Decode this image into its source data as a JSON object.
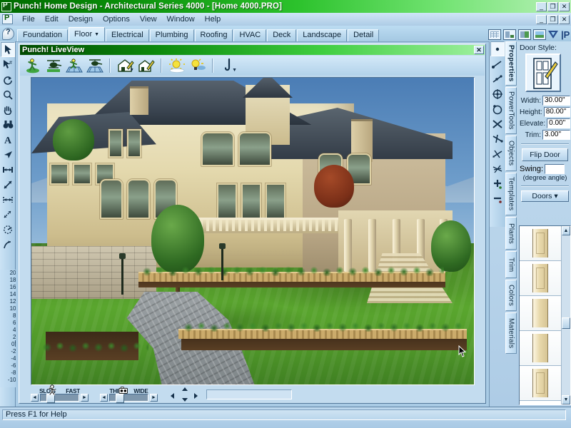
{
  "window": {
    "title": "Punch! Home Design - Architectural Series 4000 - [Home 4000.PRO]",
    "minimize": "_",
    "restore": "❐",
    "close": "✕",
    "app_icon": "punch-logo-icon"
  },
  "menu": {
    "items": [
      "File",
      "Edit",
      "Design",
      "Options",
      "View",
      "Window",
      "Help"
    ]
  },
  "tabs": {
    "items": [
      {
        "label": "Foundation",
        "active": false,
        "caret": false
      },
      {
        "label": "Floor",
        "active": true,
        "caret": true
      },
      {
        "label": "Electrical",
        "active": false,
        "caret": false
      },
      {
        "label": "Plumbing",
        "active": false,
        "caret": false
      },
      {
        "label": "Roofing",
        "active": false,
        "caret": false
      },
      {
        "label": "HVAC",
        "active": false,
        "caret": false
      },
      {
        "label": "Deck",
        "active": false,
        "caret": false
      },
      {
        "label": "Landscape",
        "active": false,
        "caret": false
      },
      {
        "label": "Detail",
        "active": false,
        "caret": false
      }
    ],
    "view_buttons": [
      "grid-view-icon",
      "left-split-view-icon",
      "two-column-view-icon",
      "full-render-view-icon"
    ],
    "logos": [
      "filter-logo-icon",
      "punch-p-logo-icon"
    ]
  },
  "left_toolbar": {
    "tools": [
      "select-arrow-icon",
      "select-group-icon",
      "rotate-icon",
      "zoom-magnifier-icon",
      "pan-hand-icon",
      "binoculars-icon",
      "text-tool-icon",
      "arrow-pointer-icon",
      "dimension-icon",
      "diagonal-arrow-icon",
      "bracket-dimension-icon",
      "diagonal-measure-icon",
      "angle-measure-icon",
      "curve-arrow-icon"
    ]
  },
  "ruler": {
    "ticks": [
      "20'",
      "18'",
      "16'",
      "14'",
      "12'",
      "10'",
      "8'",
      "6'",
      "4'",
      "2'",
      "0'",
      "-2'",
      "-4'",
      "-6'",
      "-8'",
      "-10'"
    ],
    "current": "0'"
  },
  "liveview": {
    "title": "Punch! LiveView",
    "close": "✕",
    "tools": [
      "walk-through-icon",
      "fly-through-icon",
      "walk-on-plan-icon",
      "fly-on-plan-icon",
      "house-edit-icon",
      "house-edit-alt-icon",
      "sun-light-icon",
      "bulb-light-icon",
      "pen-tool-icon"
    ],
    "controls": {
      "speed": {
        "min_label": "SLOW",
        "max_label": "FAST",
        "glyph": "walking-person-icon"
      },
      "width": {
        "min_label": "THIN",
        "max_label": "WIDE",
        "glyph": "camera-icon"
      },
      "dpad": "direction-pad-icon"
    }
  },
  "properties": {
    "door_style_label": "Door Style:",
    "door_style_icon": "door-preview-icon",
    "fields": [
      {
        "label": "Width:",
        "value": "30.00\""
      },
      {
        "label": "Height:",
        "value": "80.00\""
      },
      {
        "label": "Elevate:",
        "value": "0.00\""
      },
      {
        "label": "Trim:",
        "value": "3.00\""
      }
    ],
    "flip_button": "Flip Door",
    "swing_label": "Swing:",
    "swing_value": "",
    "swing_note": "(degree angle)",
    "catalog_header": "Doors",
    "catalog_caret": "▾",
    "catalog_items": [
      "door-thumb-1",
      "door-thumb-2",
      "door-thumb-3",
      "door-thumb-4",
      "door-thumb-5"
    ],
    "scroll_up": "▲",
    "scroll_down": "▼"
  },
  "vertical_tabs": [
    {
      "label": "Properties",
      "active": true,
      "caret": "▾"
    },
    {
      "label": "PowerTools",
      "active": false,
      "caret": ""
    },
    {
      "label": "Objects",
      "active": false,
      "caret": ""
    },
    {
      "label": "Templates",
      "active": false,
      "caret": ""
    },
    {
      "label": "Plants",
      "active": false,
      "caret": ""
    },
    {
      "label": "Trim",
      "active": false,
      "caret": ""
    },
    {
      "label": "Colors",
      "active": false,
      "caret": ""
    },
    {
      "label": "Materials",
      "active": false,
      "caret": ""
    }
  ],
  "statusbar": {
    "text": "Press F1 for Help"
  },
  "colors": {
    "title_green": "#2cc22c",
    "panel_blue": "#b8d8ef",
    "sky_blue": "#6f9ecb",
    "lawn_green": "#5aa62e",
    "roof_slate": "#39434f",
    "wall_cream": "#e4d9ae"
  }
}
